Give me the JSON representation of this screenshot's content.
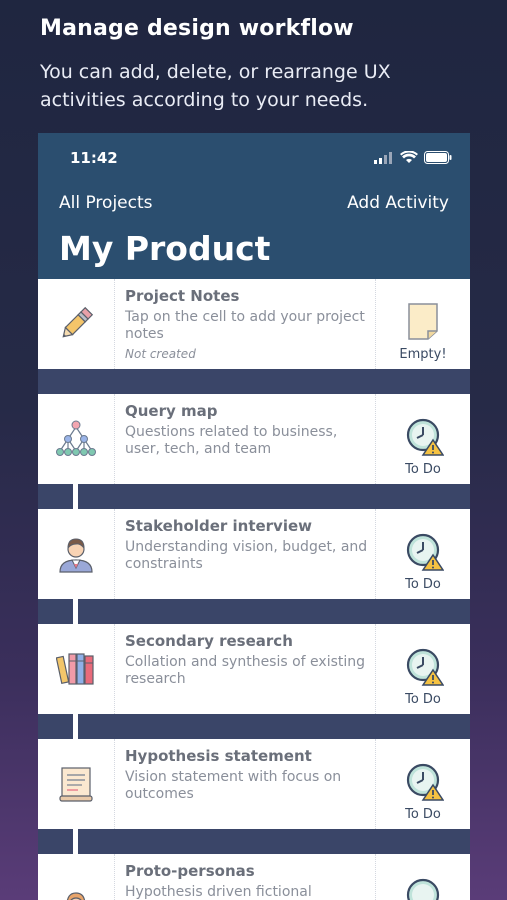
{
  "promo": {
    "title": "Manage design workflow",
    "subtitle": "You can add, delete, or rearrange UX activities according to your needs."
  },
  "status_bar": {
    "time": "11:42"
  },
  "nav": {
    "back_label": "All Projects",
    "add_label": "Add Activity",
    "title": "My Product"
  },
  "cards": [
    {
      "title": "Project Notes",
      "desc": "Tap on the cell to add your project notes",
      "note": "Not created",
      "status": "Empty!"
    },
    {
      "title": "Query map",
      "desc": "Questions related to business, user, tech, and team",
      "status": "To Do"
    },
    {
      "title": "Stakeholder interview",
      "desc": "Understanding vision, budget, and constraints",
      "status": "To Do"
    },
    {
      "title": "Secondary research",
      "desc": "Collation and synthesis of existing research",
      "status": "To Do"
    },
    {
      "title": "Hypothesis statement",
      "desc": "Vision statement with focus on outcomes",
      "status": "To Do"
    },
    {
      "title": "Proto-personas",
      "desc": "Hypothesis driven fictional",
      "status": ""
    }
  ],
  "colors": {
    "nav_bg": "#2b4e6f",
    "separator": "#3a4568",
    "card_bg": "#ffffff",
    "status_text": "#3a4a63"
  }
}
